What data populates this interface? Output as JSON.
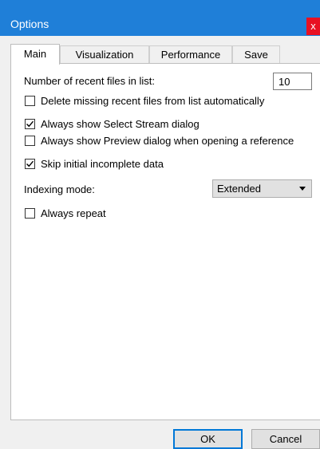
{
  "window": {
    "title": "Options",
    "close_label": "x"
  },
  "tabs": [
    {
      "label": "Main",
      "active": true
    },
    {
      "label": "Visualization",
      "active": false
    },
    {
      "label": "Performance",
      "active": false
    },
    {
      "label": "Save",
      "active": false
    }
  ],
  "main": {
    "recent_files_label": "Number of recent files in list:",
    "recent_files_value": "10",
    "checkboxes": [
      {
        "label": "Delete missing recent files from list automatically",
        "checked": false
      },
      {
        "label": "Always show Select Stream dialog",
        "checked": true
      },
      {
        "label": "Always show Preview dialog when opening a reference",
        "checked": false
      },
      {
        "label": "Skip initial incomplete data",
        "checked": true
      }
    ],
    "indexing_mode_label": "Indexing mode:",
    "indexing_mode_value": "Extended",
    "always_repeat_label": "Always repeat",
    "always_repeat_checked": false
  },
  "buttons": {
    "ok_label": "OK",
    "cancel_label": "Cancel"
  },
  "colors": {
    "titlebar": "#1f7fd8",
    "close_button": "#e81123",
    "default_button_border": "#0078d7"
  }
}
